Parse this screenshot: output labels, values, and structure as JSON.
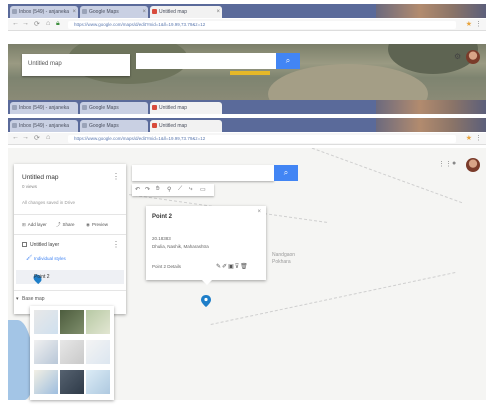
{
  "tabs": [
    {
      "label": "Inbox (549) - anjaneka",
      "active": false
    },
    {
      "label": "Google Maps",
      "active": false
    },
    {
      "label": "Untitled map",
      "active": true
    }
  ],
  "address": {
    "url": "https://www.google.com/maps/d/edit?mid=1&ll=19.99,73.79&z=12"
  },
  "map": {
    "title": "Untitled map",
    "views": "0 views",
    "note": "All changes saved in Drive",
    "actions": {
      "add_layer": "Add layer",
      "share": "Share",
      "preview": "Preview"
    },
    "layer": {
      "name": "Untitled layer",
      "style": "Individual styles",
      "point": "Point 2"
    },
    "base_map": "Base map",
    "label_region": "Nandgaon",
    "label_region2": "Pokhara"
  },
  "infowindow": {
    "title": "Point 2",
    "coords": "20.18383",
    "location": "Dhulia, Nashik, Maharashtra",
    "footer": "Point 2 Details"
  },
  "colors": {
    "accent": "#4285f4",
    "pin": "#1e7ec8",
    "tab_strip": "#5a6a9a"
  }
}
